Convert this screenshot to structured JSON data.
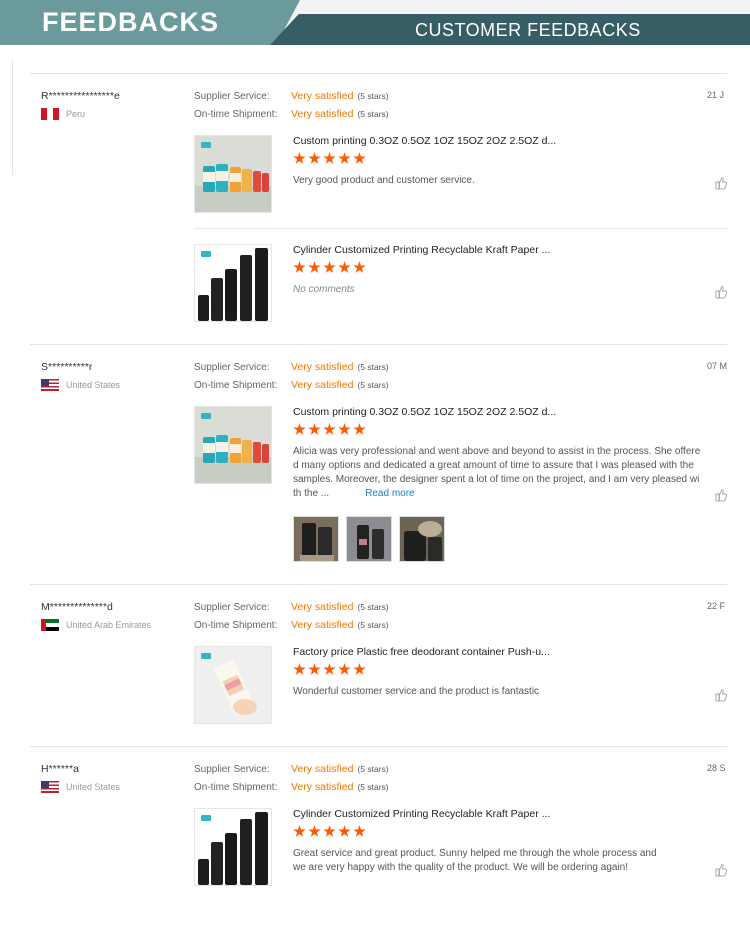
{
  "header": {
    "left_title": "FEEDBACKS",
    "right_title": "CUSTOMER FEEDBACKS",
    "left_color": "#6a9a9c",
    "right_color": "#365e64"
  },
  "labels": {
    "supplier_service": "Supplier Service:",
    "on_time_shipment": "On-time Shipment:",
    "stars_note": "(5 stars)",
    "read_more": "Read more"
  },
  "colors": {
    "accent_orange": "#f07800",
    "star": "#ff5a00",
    "link": "#1a7ac7"
  },
  "reviews": [
    {
      "user": "R****************e",
      "country": "Peru",
      "flag": "peru",
      "date": "21 J",
      "supplier_service": "Very satisfied",
      "on_time_shipment": "Very satisfied",
      "products": [
        {
          "title": "Custom printing 0.3OZ 0.5OZ 1OZ 15OZ 2OZ 2.5OZ d...",
          "stars": 5,
          "comment": "Very good product and customer service.",
          "image": "colorful-tubes-image"
        },
        {
          "title": "Cylinder Customized Printing Recyclable Kraft Paper ...",
          "stars": 5,
          "comment": "No comments",
          "image": "black-tubes-image"
        }
      ]
    },
    {
      "user": "S**********r",
      "country": "United States",
      "flag": "us",
      "date": "07 M",
      "supplier_service": "Very satisfied",
      "on_time_shipment": "Very satisfied",
      "products": [
        {
          "title": "Custom printing 0.3OZ 0.5OZ 1OZ 15OZ 2OZ 2.5OZ d...",
          "stars": 5,
          "comment_lines": [
            "Alicia was very professional and went above and beyond to assist in the process. She offere",
            "d many options and dedicated a great amount of time to assure that I was pleased with the",
            "samples. Moreover, the designer spent a lot of time on the project, and I am very pleased wi",
            "th the ..."
          ],
          "image": "colorful-tubes-image"
        }
      ]
    },
    {
      "user": "M**************d",
      "country": "United Arab Emirates",
      "flag": "uae",
      "date": "22 F",
      "supplier_service": "Very satisfied",
      "on_time_shipment": "Very satisfied",
      "products": [
        {
          "title": "Factory price Plastic free deodorant container Push-u...",
          "stars": 5,
          "comment": "Wonderful customer service and the product is fantastic",
          "image": "deodorant-image"
        }
      ]
    },
    {
      "user": "H******a",
      "country": "United States",
      "flag": "us",
      "date": "28 S",
      "supplier_service": "Very satisfied",
      "on_time_shipment": "Very satisfied",
      "products": [
        {
          "title": "Cylinder Customized Printing Recyclable Kraft Paper ...",
          "stars": 5,
          "comment_lines": [
            "Great service and great product. Sunny helped me through the whole process and",
            "we are very happy with the quality of the product. We will be ordering again!"
          ],
          "image": "black-tubes-image"
        }
      ]
    }
  ]
}
